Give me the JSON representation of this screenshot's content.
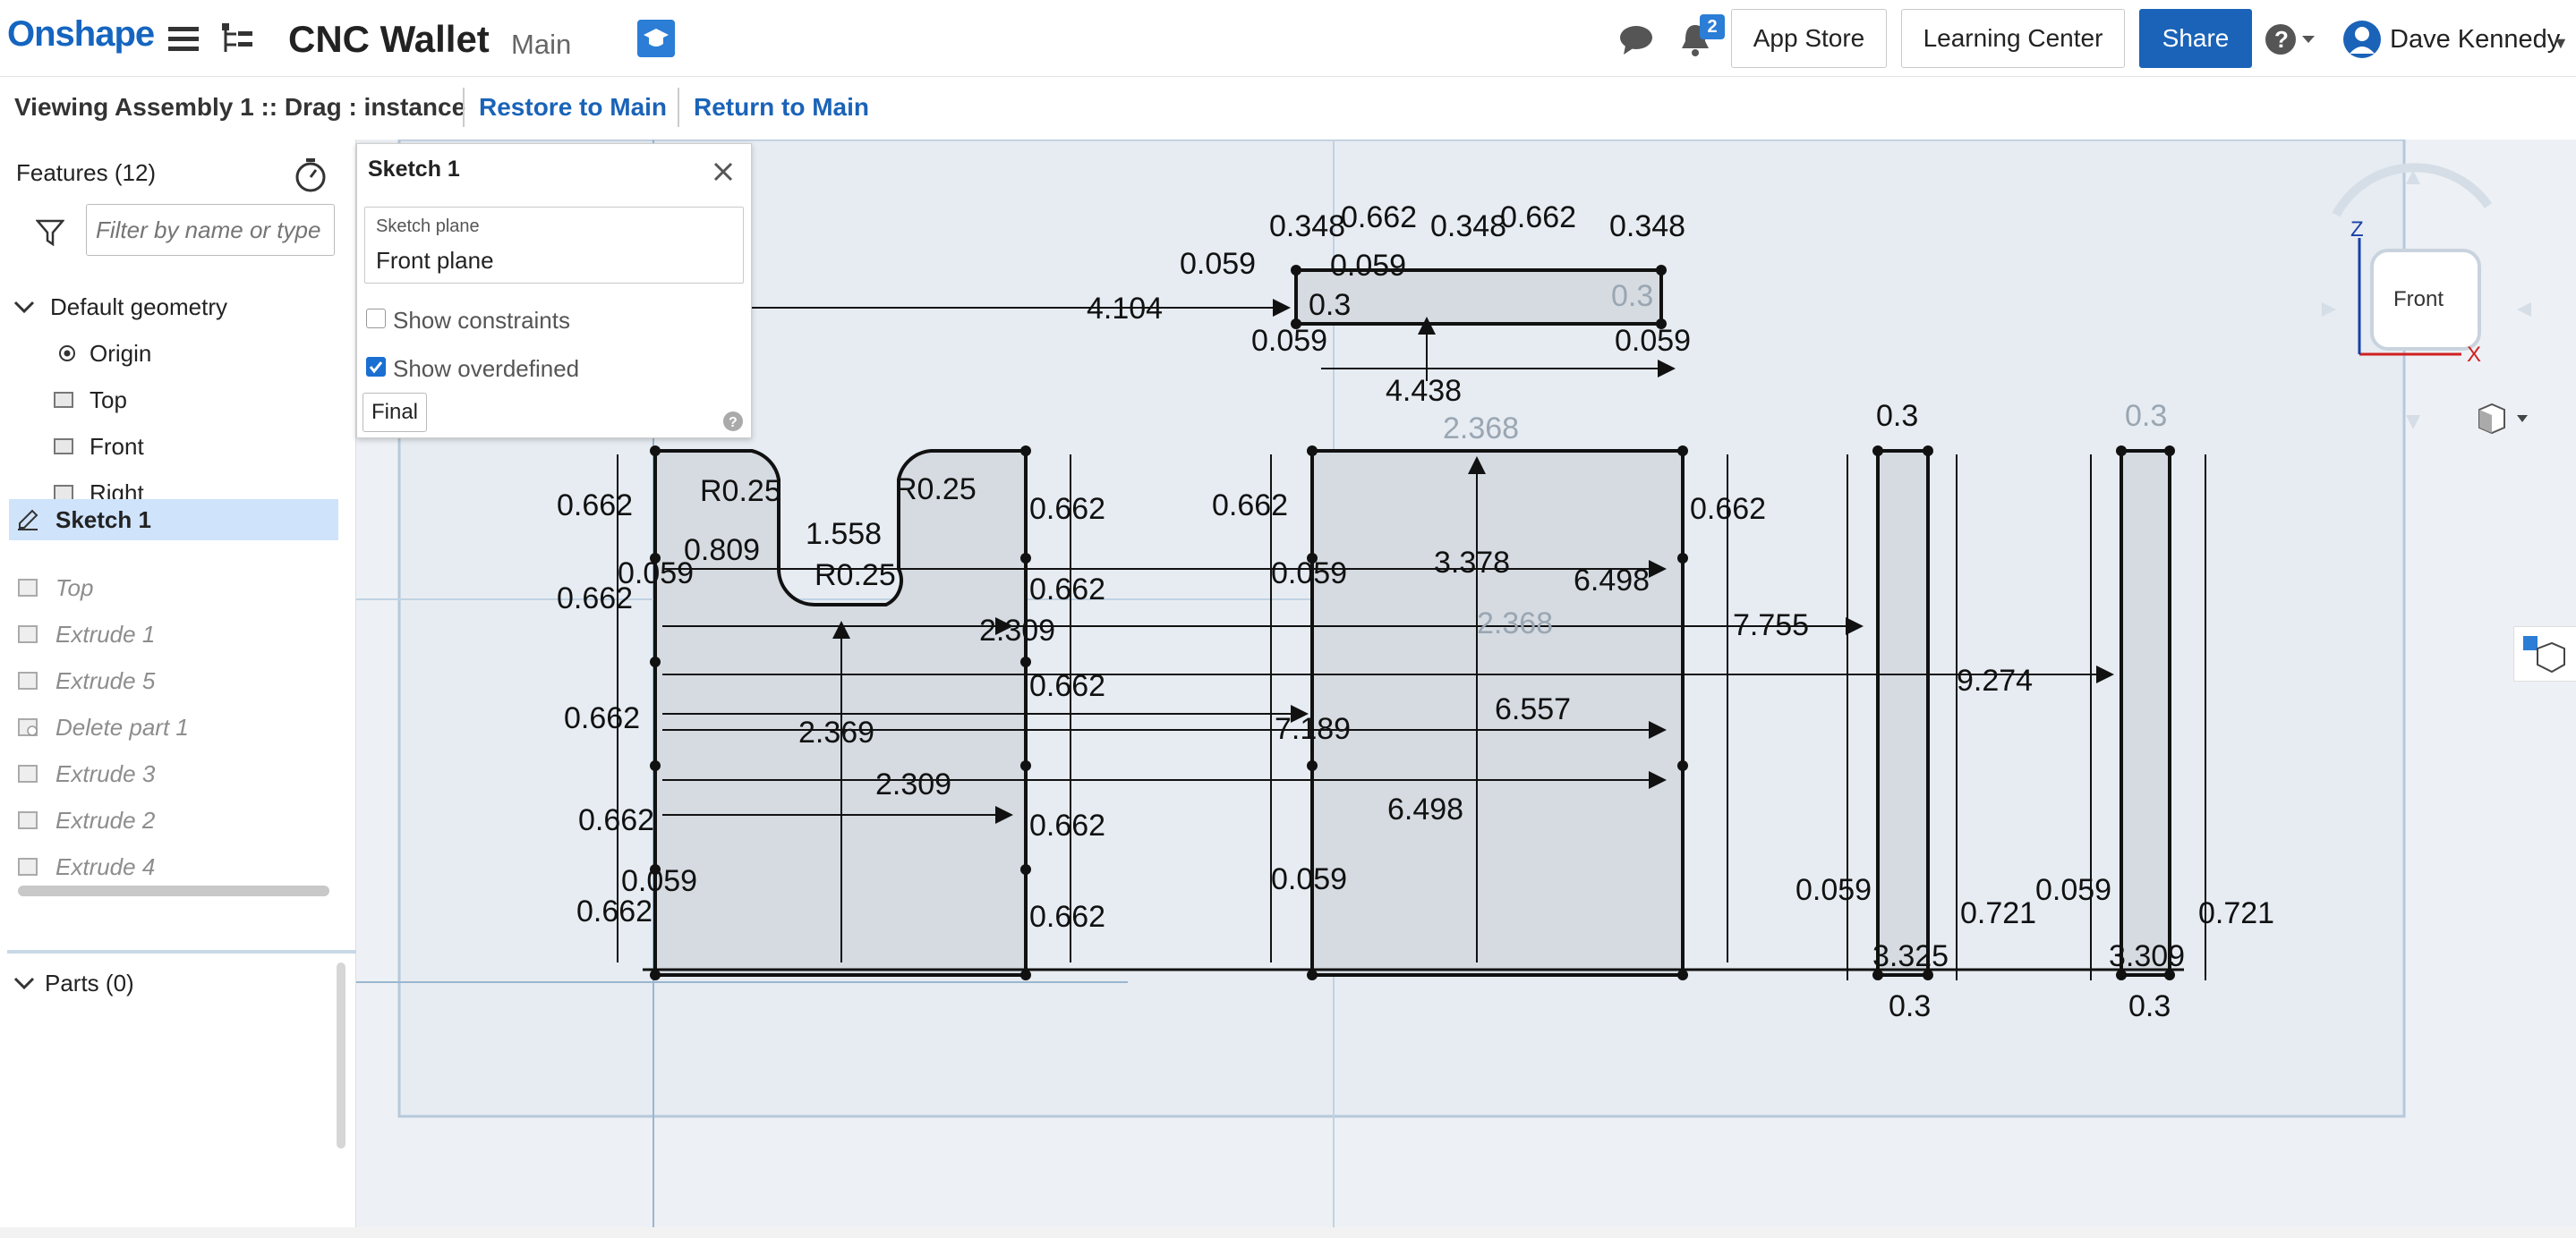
{
  "header": {
    "logo": "Onshape",
    "document_title": "CNC Wallet",
    "branch": "Main",
    "notification_count": "2",
    "app_store": "App Store",
    "learning_center": "Learning Center",
    "share": "Share",
    "user_name": "Dave Kennedy"
  },
  "breadcrumb": {
    "viewing": "Viewing Assembly 1 :: Drag : instance",
    "restore": "Restore to Main",
    "return": "Return to Main"
  },
  "features": {
    "title": "Features (12)",
    "filter_placeholder": "Filter by name or type",
    "default_geometry": "Default geometry",
    "items": [
      {
        "label": "Origin",
        "icon": "origin-icon",
        "state": "normal"
      },
      {
        "label": "Top",
        "icon": "plane-icon",
        "state": "normal"
      },
      {
        "label": "Front",
        "icon": "plane-icon",
        "state": "normal"
      },
      {
        "label": "Right",
        "icon": "plane-icon",
        "state": "normal"
      },
      {
        "label": "Sketch 1",
        "icon": "sketch-icon",
        "state": "selected"
      },
      {
        "label": "Top",
        "icon": "plane-icon",
        "state": "rolled-back"
      },
      {
        "label": "Extrude 1",
        "icon": "extrude-icon",
        "state": "rolled-back"
      },
      {
        "label": "Extrude 5",
        "icon": "extrude-icon",
        "state": "rolled-back"
      },
      {
        "label": "Delete part 1",
        "icon": "delete-part-icon",
        "state": "rolled-back"
      },
      {
        "label": "Extrude 3",
        "icon": "extrude-icon",
        "state": "rolled-back"
      },
      {
        "label": "Extrude 2",
        "icon": "extrude-icon",
        "state": "rolled-back"
      },
      {
        "label": "Extrude 4",
        "icon": "extrude-icon",
        "state": "rolled-back"
      }
    ],
    "parts": "Parts (0)"
  },
  "sketch_dialog": {
    "title": "Sketch 1",
    "plane_label": "Sketch plane",
    "plane_value": "Front plane",
    "show_constraints": "Show constraints",
    "show_constraints_checked": false,
    "show_overdefined": "Show overdefined",
    "show_overdefined_checked": true,
    "final": "Final"
  },
  "view_cube": {
    "face": "Front",
    "axis_z": "Z",
    "axis_x": "X"
  },
  "sketch_dimensions": [
    "0.348",
    "0.662",
    "0.348",
    "0.662",
    "0.348",
    "0.059",
    "0.059",
    "0.3",
    "0.3",
    "0.059",
    "0.059",
    "4.104",
    "4.438",
    "2.368",
    "2.368",
    "0.662",
    "0.662",
    "0.662",
    "0.662",
    "0.662",
    "0.662",
    "0.662",
    "0.662",
    "0.662",
    "0.662",
    "0.662",
    "0.662",
    "R0.25",
    "R0.25",
    "R0.25",
    "0.809",
    "1.558",
    "2.309",
    "2.309",
    "2.369",
    "0.059",
    "0.059",
    "0.059",
    "0.059",
    "3.378",
    "6.498",
    "6.557",
    "6.498",
    "7.755",
    "7.189",
    "9.274",
    "0.3",
    "0.3",
    "0.059",
    "0.059",
    "0.721",
    "0.721",
    "3.325",
    "3.309",
    "0.3",
    "0.3"
  ]
}
